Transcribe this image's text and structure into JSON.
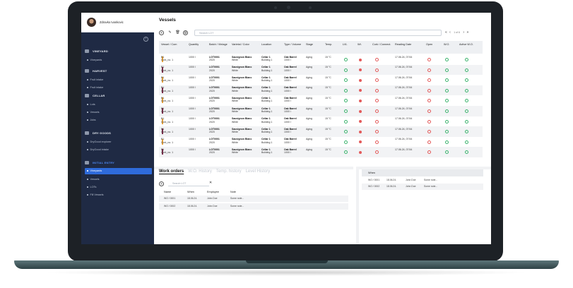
{
  "user": {
    "name": "Zdravko Ivankovic"
  },
  "sidebar": {
    "sections": [
      {
        "label": "VINEYARD",
        "items": [
          "Vineyards"
        ]
      },
      {
        "label": "HARVEST",
        "items": [
          "Fruit intake",
          "Fruit intake"
        ]
      },
      {
        "label": "CELLAR",
        "items": [
          "Lots",
          "Vessels",
          "Jobs"
        ]
      },
      {
        "label": "DRY GOODS",
        "items": [
          "DryGood explorer",
          "DryGood intake"
        ]
      },
      {
        "label": "INITIAL ENTRY",
        "items": [
          "Vineyards",
          "Vessels",
          "LOTs",
          "Fill Vessels"
        ]
      }
    ],
    "active_item": "Vineyards"
  },
  "page": {
    "title": "Vessels"
  },
  "toolbar": {
    "search_placeholder": "Search LOT",
    "pagination": "« ‹   1 of 6   › »",
    "page_text": "1 of 6"
  },
  "table": {
    "headers": [
      "Vessel / Com",
      "Quantity",
      "Batch / Vintage",
      "Varietal / Color",
      "Location",
      "Type / Volume",
      "Stage",
      "Temp.",
      "LVL",
      "Wt.",
      "Cork / Connect.",
      "Reading Date",
      "Open",
      "W.O.",
      "Active W.O."
    ],
    "rows": [
      {
        "vessel": "B1",
        "com": "Cork_no. 1",
        "qty": "1000 l",
        "batch": "LOT0001",
        "vintage": "2020",
        "varietal": "Sauvignon Blanc",
        "color": "White",
        "loc": "Cellar 1",
        "bld": "Building 1",
        "type": "Oak Barrel",
        "vol": "1000 l",
        "stage": "Aging",
        "temp": "15 °C",
        "date": "17.06.24, 07:54",
        "bar": "#e6a23c"
      },
      {
        "vessel": "B1",
        "com": "Cork_no. 1",
        "qty": "1000 l",
        "batch": "LOT0001",
        "vintage": "2020",
        "varietal": "Sauvignon Blanc",
        "color": "White",
        "loc": "Cellar 1",
        "bld": "Building 1",
        "type": "Oak Barrel",
        "vol": "1000 l",
        "stage": "Aging",
        "temp": "15 °C",
        "date": "17.06.24, 07:54",
        "bar": "#7b2c4a"
      },
      {
        "vessel": "B1",
        "com": "Cork_no. 1",
        "qty": "1000 l",
        "batch": "LOT0001",
        "vintage": "2020",
        "varietal": "Sauvignon Blanc",
        "color": "White",
        "loc": "Cellar 1",
        "bld": "Building 1",
        "type": "Oak Barrel",
        "vol": "1000 l",
        "stage": "Aging",
        "temp": "15 °C",
        "date": "17.06.24, 07:54",
        "bar": "#e6a23c"
      },
      {
        "vessel": "B1",
        "com": "Cork_no. 1",
        "qty": "1000 l",
        "batch": "LOT0001",
        "vintage": "2020",
        "varietal": "Sauvignon Blanc",
        "color": "White",
        "loc": "Cellar 1",
        "bld": "Building 1",
        "type": "Oak Barrel",
        "vol": "1000 l",
        "stage": "Aging",
        "temp": "15 °C",
        "date": "17.06.24, 07:54",
        "bar": "#7b2c4a"
      },
      {
        "vessel": "B1",
        "com": "Cork_no. 1",
        "qty": "1000 l",
        "batch": "LOT0001",
        "vintage": "2020",
        "varietal": "Sauvignon Blanc",
        "color": "White",
        "loc": "Cellar 1",
        "bld": "Building 1",
        "type": "Oak Barrel",
        "vol": "1000 l",
        "stage": "Aging",
        "temp": "15 °C",
        "date": "17.06.24, 07:54",
        "bar": "#e6a23c"
      },
      {
        "vessel": "B1",
        "com": "Cork_no. 1",
        "qty": "1000 l",
        "batch": "LOT0001",
        "vintage": "2020",
        "varietal": "Sauvignon Blanc",
        "color": "White",
        "loc": "Cellar 1",
        "bld": "Building 1",
        "type": "Oak Barrel",
        "vol": "1000 l",
        "stage": "Aging",
        "temp": "15 °C",
        "date": "17.06.24, 07:54",
        "bar": "#7b2c4a"
      },
      {
        "vessel": "B1",
        "com": "Cork_no. 1",
        "qty": "1000 l",
        "batch": "LOT0001",
        "vintage": "2020",
        "varietal": "Sauvignon Blanc",
        "color": "White",
        "loc": "Cellar 1",
        "bld": "Building 1",
        "type": "Oak Barrel",
        "vol": "1000 l",
        "stage": "Aging",
        "temp": "15 °C",
        "date": "17.06.24, 07:54",
        "bar": "#e6a23c"
      },
      {
        "vessel": "B1",
        "com": "Cork_no. 1",
        "qty": "1000 l",
        "batch": "LOT0001",
        "vintage": "2020",
        "varietal": "Sauvignon Blanc",
        "color": "White",
        "loc": "Cellar 1",
        "bld": "Building 1",
        "type": "Oak Barrel",
        "vol": "1000 l",
        "stage": "Aging",
        "temp": "15 °C",
        "date": "17.06.24, 07:54",
        "bar": "#7b2c4a"
      },
      {
        "vessel": "B1",
        "com": "Cork_no. 1",
        "qty": "1000 l",
        "batch": "LOT0001",
        "vintage": "2020",
        "varietal": "Sauvignon Blanc",
        "color": "White",
        "loc": "Cellar 1",
        "bld": "Building 1",
        "type": "Oak Barrel",
        "vol": "1000 l",
        "stage": "Aging",
        "temp": "15 °C",
        "date": "17.06.24, 07:54",
        "bar": "#e6a23c"
      },
      {
        "vessel": "B1",
        "com": "Cork_no. 1",
        "qty": "1000 l",
        "batch": "LOT0001",
        "vintage": "2020",
        "varietal": "Sauvignon Blanc",
        "color": "White",
        "loc": "Cellar 1",
        "bld": "Building 1",
        "type": "Oak Barrel",
        "vol": "1000 l",
        "stage": "Aging",
        "temp": "15 °C",
        "date": "17.06.24, 07:54",
        "bar": "#7b2c4a"
      }
    ]
  },
  "bottom": {
    "tabs": [
      "Work orders",
      "W.O. History",
      "Temp. history",
      "Level History"
    ],
    "search_placeholder": "Search LOT",
    "headers": [
      "Name",
      "When",
      "Employee",
      "Note"
    ],
    "rows": [
      {
        "name": "WO / 0001",
        "when": "18.06.24.",
        "emp": "John Doe",
        "note": "Some note..."
      },
      {
        "name": "WO / 0002",
        "when": "18.06.24.",
        "emp": "John Doe",
        "note": "Some note..."
      }
    ],
    "right_header": "When",
    "right_rows": [
      {
        "name": "WO / 0001",
        "when": "18.06.24.",
        "emp": "John Doe",
        "note": "Some note..."
      },
      {
        "name": "WO / 0002",
        "when": "18.06.24.",
        "emp": "John Doe",
        "note": "Some note..."
      }
    ]
  }
}
